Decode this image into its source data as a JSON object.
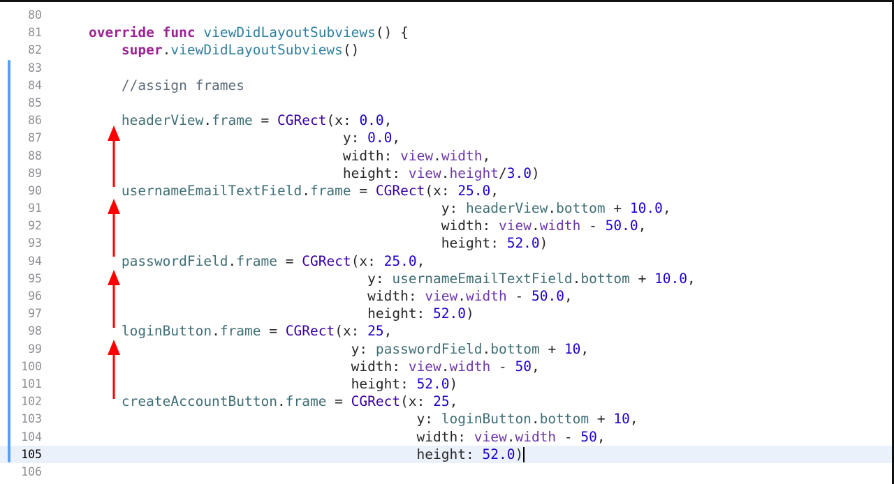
{
  "editor": {
    "language": "swift",
    "current_line": 105,
    "colors": {
      "keyword": "#9b2393",
      "function": "#2f7f9e",
      "property": "#3f6e74",
      "number": "#1c00cf",
      "comment": "#5d6c79",
      "type": "#3900a0",
      "change_bar": "#5a9ef0",
      "current_line_bg": "#eaf1fb",
      "arrow": "#ff0000"
    },
    "lines": [
      {
        "n": "80",
        "tokens": []
      },
      {
        "n": "81",
        "tokens": [
          [
            "",
            "    "
          ],
          [
            "kw",
            "override"
          ],
          [
            "",
            " "
          ],
          [
            "kw",
            "func"
          ],
          [
            "",
            " "
          ],
          [
            "fn",
            "viewDidLayoutSubviews"
          ],
          [
            "",
            "() {"
          ]
        ]
      },
      {
        "n": "82",
        "tokens": [
          [
            "",
            "        "
          ],
          [
            "kw",
            "super"
          ],
          [
            "",
            "."
          ],
          [
            "fn",
            "viewDidLayoutSubviews"
          ],
          [
            "",
            "()"
          ]
        ]
      },
      {
        "n": "83",
        "tokens": []
      },
      {
        "n": "84",
        "tokens": [
          [
            "",
            "        "
          ],
          [
            "cm",
            "//assign frames"
          ]
        ]
      },
      {
        "n": "85",
        "tokens": []
      },
      {
        "n": "86",
        "tokens": [
          [
            "",
            "        "
          ],
          [
            "var",
            "headerView"
          ],
          [
            "",
            "."
          ],
          [
            "prop",
            "frame"
          ],
          [
            "",
            " = "
          ],
          [
            "type",
            "CGRect"
          ],
          [
            "",
            "(x: "
          ],
          [
            "num",
            "0.0"
          ],
          [
            "",
            ","
          ]
        ]
      },
      {
        "n": "87",
        "tokens": [
          [
            "",
            "                                   y: "
          ],
          [
            "num",
            "0.0"
          ],
          [
            "",
            ","
          ]
        ]
      },
      {
        "n": "88",
        "tokens": [
          [
            "",
            "                                   width: "
          ],
          [
            "mem",
            "view"
          ],
          [
            "",
            "."
          ],
          [
            "mem",
            "width"
          ],
          [
            "",
            ","
          ]
        ]
      },
      {
        "n": "89",
        "tokens": [
          [
            "",
            "                                   height: "
          ],
          [
            "mem",
            "view"
          ],
          [
            "",
            "."
          ],
          [
            "mem",
            "height"
          ],
          [
            "",
            "/"
          ],
          [
            "num",
            "3.0"
          ],
          [
            "",
            ")"
          ]
        ]
      },
      {
        "n": "90",
        "tokens": [
          [
            "",
            "        "
          ],
          [
            "var",
            "usernameEmailTextField"
          ],
          [
            "",
            "."
          ],
          [
            "prop",
            "frame"
          ],
          [
            "",
            " = "
          ],
          [
            "type",
            "CGRect"
          ],
          [
            "",
            "(x: "
          ],
          [
            "num",
            "25.0"
          ],
          [
            "",
            ","
          ]
        ]
      },
      {
        "n": "91",
        "tokens": [
          [
            "",
            "                                               y: "
          ],
          [
            "var",
            "headerView"
          ],
          [
            "",
            "."
          ],
          [
            "prop",
            "bottom"
          ],
          [
            "",
            " + "
          ],
          [
            "num",
            "10.0"
          ],
          [
            "",
            ","
          ]
        ]
      },
      {
        "n": "92",
        "tokens": [
          [
            "",
            "                                               width: "
          ],
          [
            "mem",
            "view"
          ],
          [
            "",
            "."
          ],
          [
            "mem",
            "width"
          ],
          [
            "",
            " - "
          ],
          [
            "num",
            "50.0"
          ],
          [
            "",
            ","
          ]
        ]
      },
      {
        "n": "93",
        "tokens": [
          [
            "",
            "                                               height: "
          ],
          [
            "num",
            "52.0"
          ],
          [
            "",
            ")"
          ]
        ]
      },
      {
        "n": "94",
        "tokens": [
          [
            "",
            "        "
          ],
          [
            "var",
            "passwordField"
          ],
          [
            "",
            "."
          ],
          [
            "prop",
            "frame"
          ],
          [
            "",
            " = "
          ],
          [
            "type",
            "CGRect"
          ],
          [
            "",
            "(x: "
          ],
          [
            "num",
            "25.0"
          ],
          [
            "",
            ","
          ]
        ]
      },
      {
        "n": "95",
        "tokens": [
          [
            "",
            "                                      y: "
          ],
          [
            "var",
            "usernameEmailTextField"
          ],
          [
            "",
            "."
          ],
          [
            "prop",
            "bottom"
          ],
          [
            "",
            " + "
          ],
          [
            "num",
            "10.0"
          ],
          [
            "",
            ","
          ]
        ]
      },
      {
        "n": "96",
        "tokens": [
          [
            "",
            "                                      width: "
          ],
          [
            "mem",
            "view"
          ],
          [
            "",
            "."
          ],
          [
            "mem",
            "width"
          ],
          [
            "",
            " - "
          ],
          [
            "num",
            "50.0"
          ],
          [
            "",
            ","
          ]
        ]
      },
      {
        "n": "97",
        "tokens": [
          [
            "",
            "                                      height: "
          ],
          [
            "num",
            "52.0"
          ],
          [
            "",
            ")"
          ]
        ]
      },
      {
        "n": "98",
        "tokens": [
          [
            "",
            "        "
          ],
          [
            "var",
            "loginButton"
          ],
          [
            "",
            "."
          ],
          [
            "prop",
            "frame"
          ],
          [
            "",
            " = "
          ],
          [
            "type",
            "CGRect"
          ],
          [
            "",
            "(x: "
          ],
          [
            "num",
            "25"
          ],
          [
            "",
            ","
          ]
        ]
      },
      {
        "n": "99",
        "tokens": [
          [
            "",
            "                                    y: "
          ],
          [
            "var",
            "passwordField"
          ],
          [
            "",
            "."
          ],
          [
            "prop",
            "bottom"
          ],
          [
            "",
            " + "
          ],
          [
            "num",
            "10"
          ],
          [
            "",
            ","
          ]
        ]
      },
      {
        "n": "100",
        "tokens": [
          [
            "",
            "                                    width: "
          ],
          [
            "mem",
            "view"
          ],
          [
            "",
            "."
          ],
          [
            "mem",
            "width"
          ],
          [
            "",
            " - "
          ],
          [
            "num",
            "50"
          ],
          [
            "",
            ","
          ]
        ]
      },
      {
        "n": "101",
        "tokens": [
          [
            "",
            "                                    height: "
          ],
          [
            "num",
            "52.0"
          ],
          [
            "",
            ")"
          ]
        ]
      },
      {
        "n": "102",
        "tokens": [
          [
            "",
            "        "
          ],
          [
            "var",
            "createAccountButton"
          ],
          [
            "",
            "."
          ],
          [
            "prop",
            "frame"
          ],
          [
            "",
            " = "
          ],
          [
            "type",
            "CGRect"
          ],
          [
            "",
            "(x: "
          ],
          [
            "num",
            "25"
          ],
          [
            "",
            ","
          ]
        ]
      },
      {
        "n": "103",
        "tokens": [
          [
            "",
            "                                            y: "
          ],
          [
            "var",
            "loginButton"
          ],
          [
            "",
            "."
          ],
          [
            "prop",
            "bottom"
          ],
          [
            "",
            " + "
          ],
          [
            "num",
            "10"
          ],
          [
            "",
            ","
          ]
        ]
      },
      {
        "n": "104",
        "tokens": [
          [
            "",
            "                                            width: "
          ],
          [
            "mem",
            "view"
          ],
          [
            "",
            "."
          ],
          [
            "mem",
            "width"
          ],
          [
            "",
            " - "
          ],
          [
            "num",
            "50"
          ],
          [
            "",
            ","
          ]
        ]
      },
      {
        "n": "105",
        "tokens": [
          [
            "",
            "                                            height: "
          ],
          [
            "num",
            "52.0"
          ],
          [
            "",
            ")"
          ]
        ],
        "caret": true
      },
      {
        "n": "106",
        "tokens": []
      }
    ]
  }
}
